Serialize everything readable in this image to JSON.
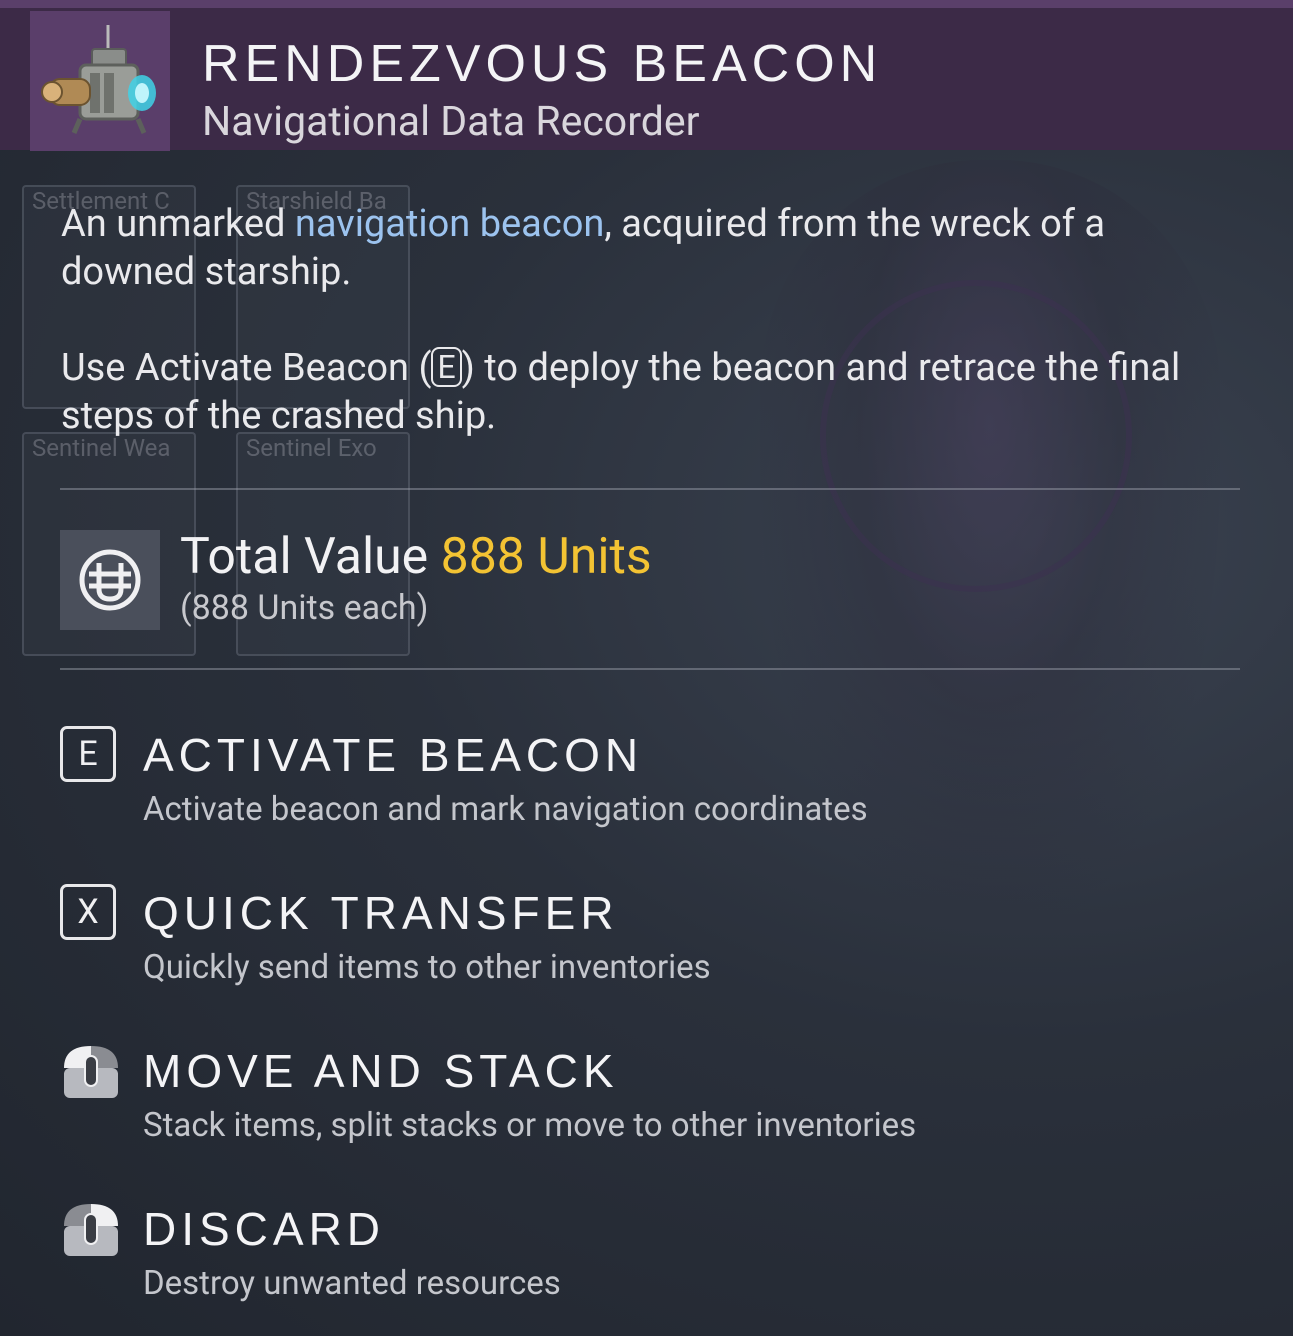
{
  "header": {
    "title": "RENDEZVOUS BEACON",
    "subtitle": "Navigational Data Recorder",
    "icon": "beacon-device-icon",
    "accent_color": "#3c2a47"
  },
  "background_slots": [
    {
      "label": "Settlement C"
    },
    {
      "label": "Starshield Ba"
    },
    {
      "label": "Sentinel Wea"
    },
    {
      "label": "Sentinel Exo"
    }
  ],
  "description": {
    "p1_before": "An unmarked ",
    "p1_link": "navigation beacon",
    "p1_after": ", acquired from the wreck of a downed starship.",
    "p2_before": "Use Activate Beacon (",
    "p2_key": "E",
    "p2_after": ") to deploy the beacon and retrace the final steps of the crashed ship.",
    "link_color": "#9cc3ef"
  },
  "value": {
    "label": "Total Value",
    "amount": "888 Units",
    "each": "(888 Units each)",
    "icon": "units-currency-icon",
    "amount_color": "#f3c333"
  },
  "actions": [
    {
      "key": "E",
      "title": "ACTIVATE BEACON",
      "desc": "Activate beacon and mark navigation coordinates"
    },
    {
      "key": "X",
      "title": "QUICK TRANSFER",
      "desc": "Quickly send items to other inventories"
    },
    {
      "key": "left-mouse-icon",
      "title": "MOVE AND STACK",
      "desc": "Stack items, split stacks or move to other inventories"
    },
    {
      "key": "right-mouse-icon",
      "title": "DISCARD",
      "desc": "Destroy unwanted resources"
    }
  ]
}
